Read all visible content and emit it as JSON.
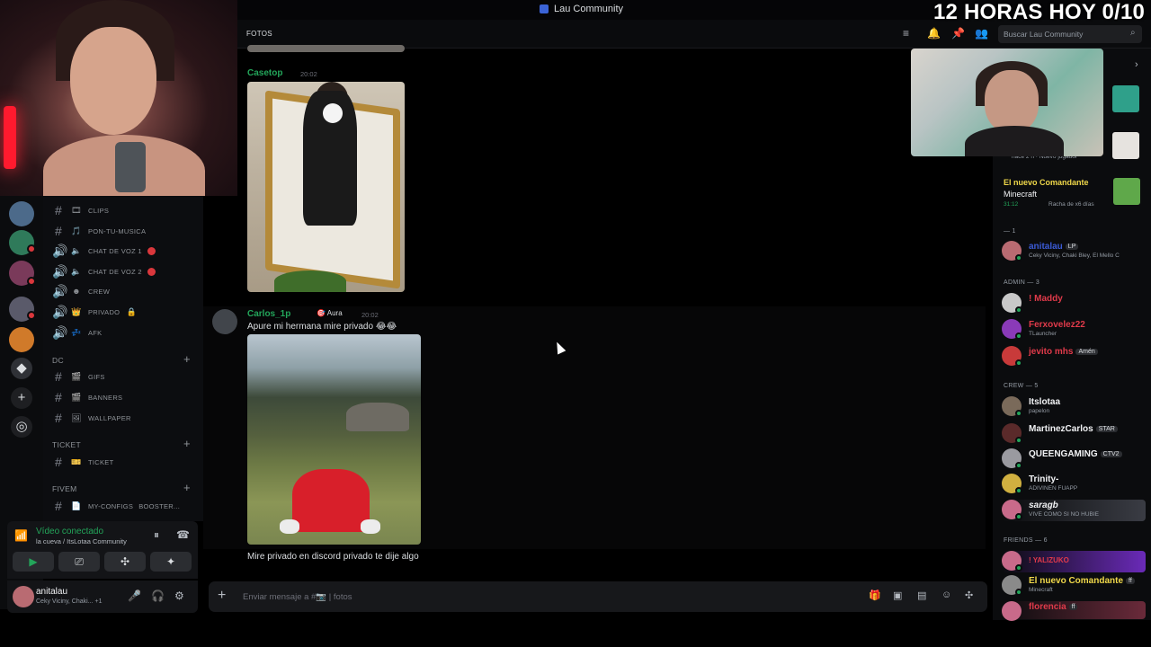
{
  "window": {
    "title": "Lau Community",
    "overlay_counter": "12 HORAS HOY 0/10"
  },
  "header": {
    "channel_name": "FOTOS",
    "search_placeholder": "Buscar Lau Community"
  },
  "channels": {
    "items": [
      {
        "label": "CLIPS"
      },
      {
        "label": "PON-TU-MUSICA"
      },
      {
        "label": "CHAT DE VOZ 1"
      },
      {
        "label": "CHAT DE VOZ 2"
      },
      {
        "label": "CREW"
      },
      {
        "label": "PRIVADO"
      },
      {
        "label": "AFK"
      },
      {
        "label": "GIFS"
      },
      {
        "label": "BANNERS"
      },
      {
        "label": "WALLPAPER"
      },
      {
        "label": "TICKET"
      },
      {
        "label": "MY-CONFIGS"
      },
      {
        "label": "BOOSTER..."
      }
    ],
    "categories": {
      "dc": "DC",
      "ticket": "TICKET",
      "fivem": "FIVEM"
    }
  },
  "voice": {
    "status": "Vídeo conectado",
    "location": "la cueva / ItsLotaa Community"
  },
  "user": {
    "name": "anitalau",
    "activity": "Ceky Viciny, Chaki...",
    "extra": "+1"
  },
  "messages": [
    {
      "author": "Casetop",
      "time": "20:02",
      "color": "#23a55a"
    },
    {
      "author": "Carlos_1p",
      "tag": "Aura",
      "time": "20:02",
      "text": "Apure mi hermana mire privado 😂😂",
      "followup": "Mire privado en discord privado te dije algo",
      "color": "#23a55a"
    }
  ],
  "composer": {
    "placeholder": "Enviar mensaje a #📷 | fotos"
  },
  "members": {
    "activity_snippet": "hace 2 h",
    "activity_snippet2": "Nuevo jugador",
    "activity_card": {
      "name": "El nuevo Comandante",
      "game": "Minecraft",
      "time": "31:12",
      "streak": "Racha de x6 días"
    },
    "group_owner": "— 1",
    "owner": {
      "name": "anitalau",
      "tag": "LP",
      "activity": "Ceky Viciny, Chaki Bley, El Mello C"
    },
    "group_admin": "ADMIN — 3",
    "admins": [
      {
        "name": "! Maddy",
        "sub": "",
        "color": "#e03a4a"
      },
      {
        "name": "Ferxovelez22",
        "sub": "TLauncher",
        "color": "#e03a4a"
      },
      {
        "name": "jevito mhs",
        "sub": "",
        "tag": "Amén",
        "color": "#e03a4a"
      }
    ],
    "group_crew": "CREW — 5",
    "crew": [
      {
        "name": "Itslotaa",
        "sub": "papelon",
        "color": "#f2f3f5"
      },
      {
        "name": "MartinezCarlos",
        "tag": "STAR",
        "color": "#f2f3f5"
      },
      {
        "name": "QUEENGAMING",
        "tag": "CTV2",
        "color": "#f2f3f5"
      },
      {
        "name": "Trinity-",
        "sub": "ADIVINEN FUAPP",
        "color": "#f2f3f5"
      },
      {
        "name": "saragb",
        "sub": "VIVE COMO SI NO HUBIE",
        "color": "#f2f3f5"
      }
    ],
    "group_friends": "FRIENDS — 6",
    "friends": [
      {
        "name": "! YALIZUKO",
        "color": "#e03a4a"
      },
      {
        "name": "El nuevo Comandante",
        "tag": "ff",
        "sub": "Minecraft",
        "color": "#f0d84a"
      },
      {
        "name": "florencia",
        "tag": "ff",
        "color": "#e03a4a"
      }
    ]
  }
}
